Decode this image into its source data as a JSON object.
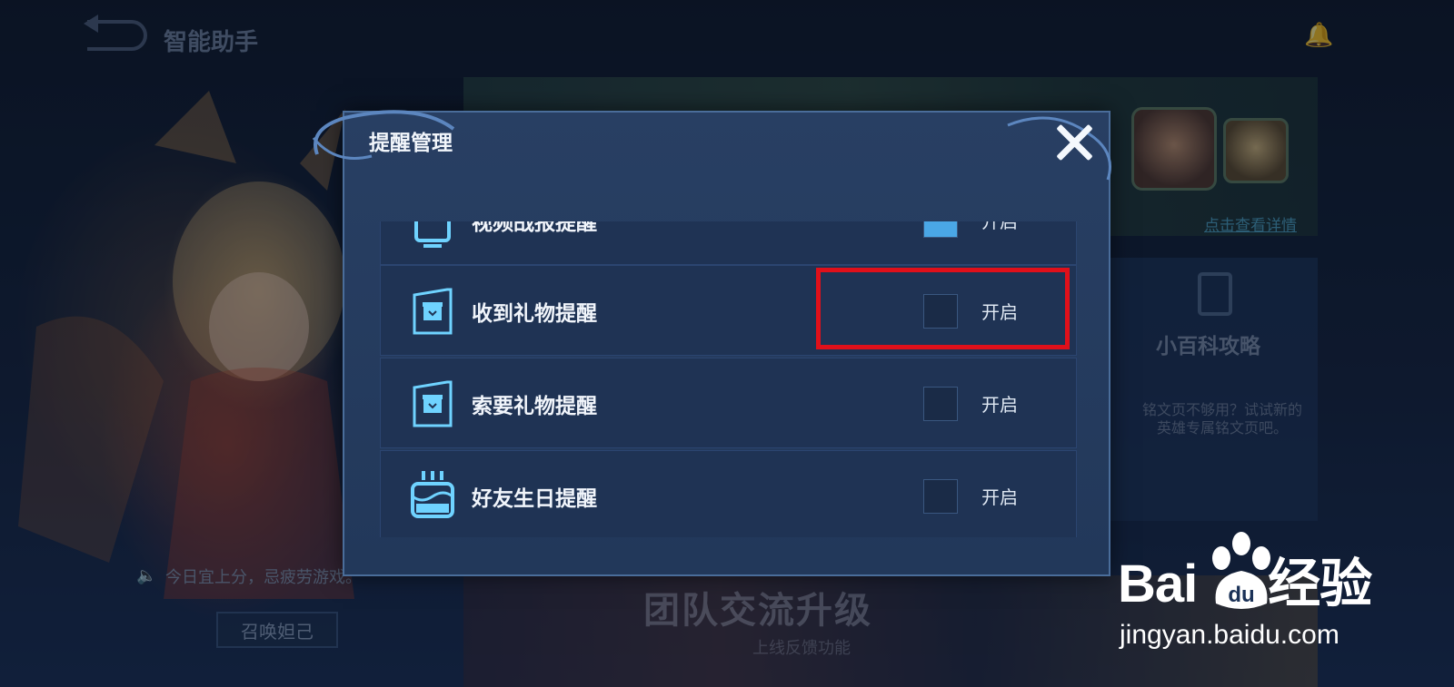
{
  "header": {
    "title": "智能助手"
  },
  "background": {
    "banner_link": "点击查看详情",
    "side_card": {
      "title": "小百科攻略",
      "desc": "铭文页不够用？试试新的英雄专属铭文页吧。"
    },
    "bottom_banner": {
      "title": "团队交流升级",
      "subtitle": "上线反馈功能"
    },
    "tip": "今日宜上分，忌疲劳游戏。",
    "summon_button": "召唤妲己"
  },
  "dialog": {
    "title": "提醒管理",
    "rows": [
      {
        "label": "视频战报提醒",
        "icon": "video-icon",
        "state_label": "开启",
        "checked": true
      },
      {
        "label": "收到礼物提醒",
        "icon": "gift-card-icon",
        "state_label": "开启",
        "checked": false
      },
      {
        "label": "索要礼物提醒",
        "icon": "gift-card-icon",
        "state_label": "开启",
        "checked": false
      },
      {
        "label": "好友生日提醒",
        "icon": "birthday-cake-icon",
        "state_label": "开启",
        "checked": false
      }
    ]
  },
  "watermark": {
    "brand": "Baidu经验",
    "brand_left": "Bai",
    "brand_right": "经验",
    "url": "jingyan.baidu.com"
  },
  "colors": {
    "highlight": "#e0101a",
    "accent": "#4aa7e6"
  }
}
